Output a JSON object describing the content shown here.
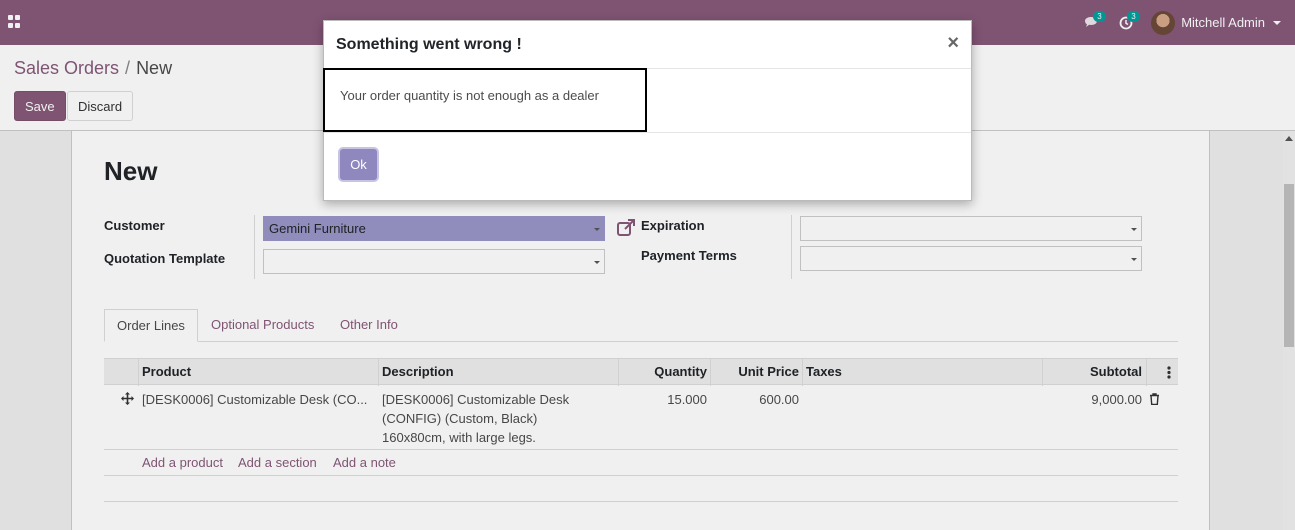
{
  "navbar": {
    "messages_badge": "3",
    "activities_badge": "3",
    "user_name": "Mitchell Admin"
  },
  "breadcrumb": {
    "parent": "Sales Orders",
    "current": "New"
  },
  "buttons": {
    "save": "Save",
    "discard": "Discard"
  },
  "form": {
    "title": "New",
    "customer_label": "Customer",
    "customer_value": "Gemini Furniture",
    "quotation_template_label": "Quotation Template",
    "quotation_template_value": "",
    "expiration_label": "Expiration",
    "expiration_value": "",
    "payment_terms_label": "Payment Terms",
    "payment_terms_value": ""
  },
  "tabs": [
    "Order Lines",
    "Optional Products",
    "Other Info"
  ],
  "table": {
    "headers": {
      "product": "Product",
      "description": "Description",
      "quantity": "Quantity",
      "unit_price": "Unit Price",
      "taxes": "Taxes",
      "subtotal": "Subtotal"
    },
    "rows": [
      {
        "product": "[DESK0006] Customizable Desk (CO...",
        "description_lines": [
          "[DESK0006] Customizable Desk",
          "(CONFIG) (Custom, Black)",
          "160x80cm, with large legs."
        ],
        "quantity": "15.000",
        "unit_price": "600.00",
        "taxes": "",
        "subtotal": "9,000.00"
      }
    ],
    "add_links": [
      "Add a product",
      "Add a section",
      "Add a note"
    ]
  },
  "modal": {
    "title": "Something went wrong !",
    "close": "×",
    "message": "Your order quantity is not enough as a dealer",
    "ok": "Ok"
  },
  "colors": {
    "brand": "#875a7b",
    "selected_field": "#9a95c8",
    "ok_button": "#8e88bf",
    "badge": "#00a09d"
  }
}
